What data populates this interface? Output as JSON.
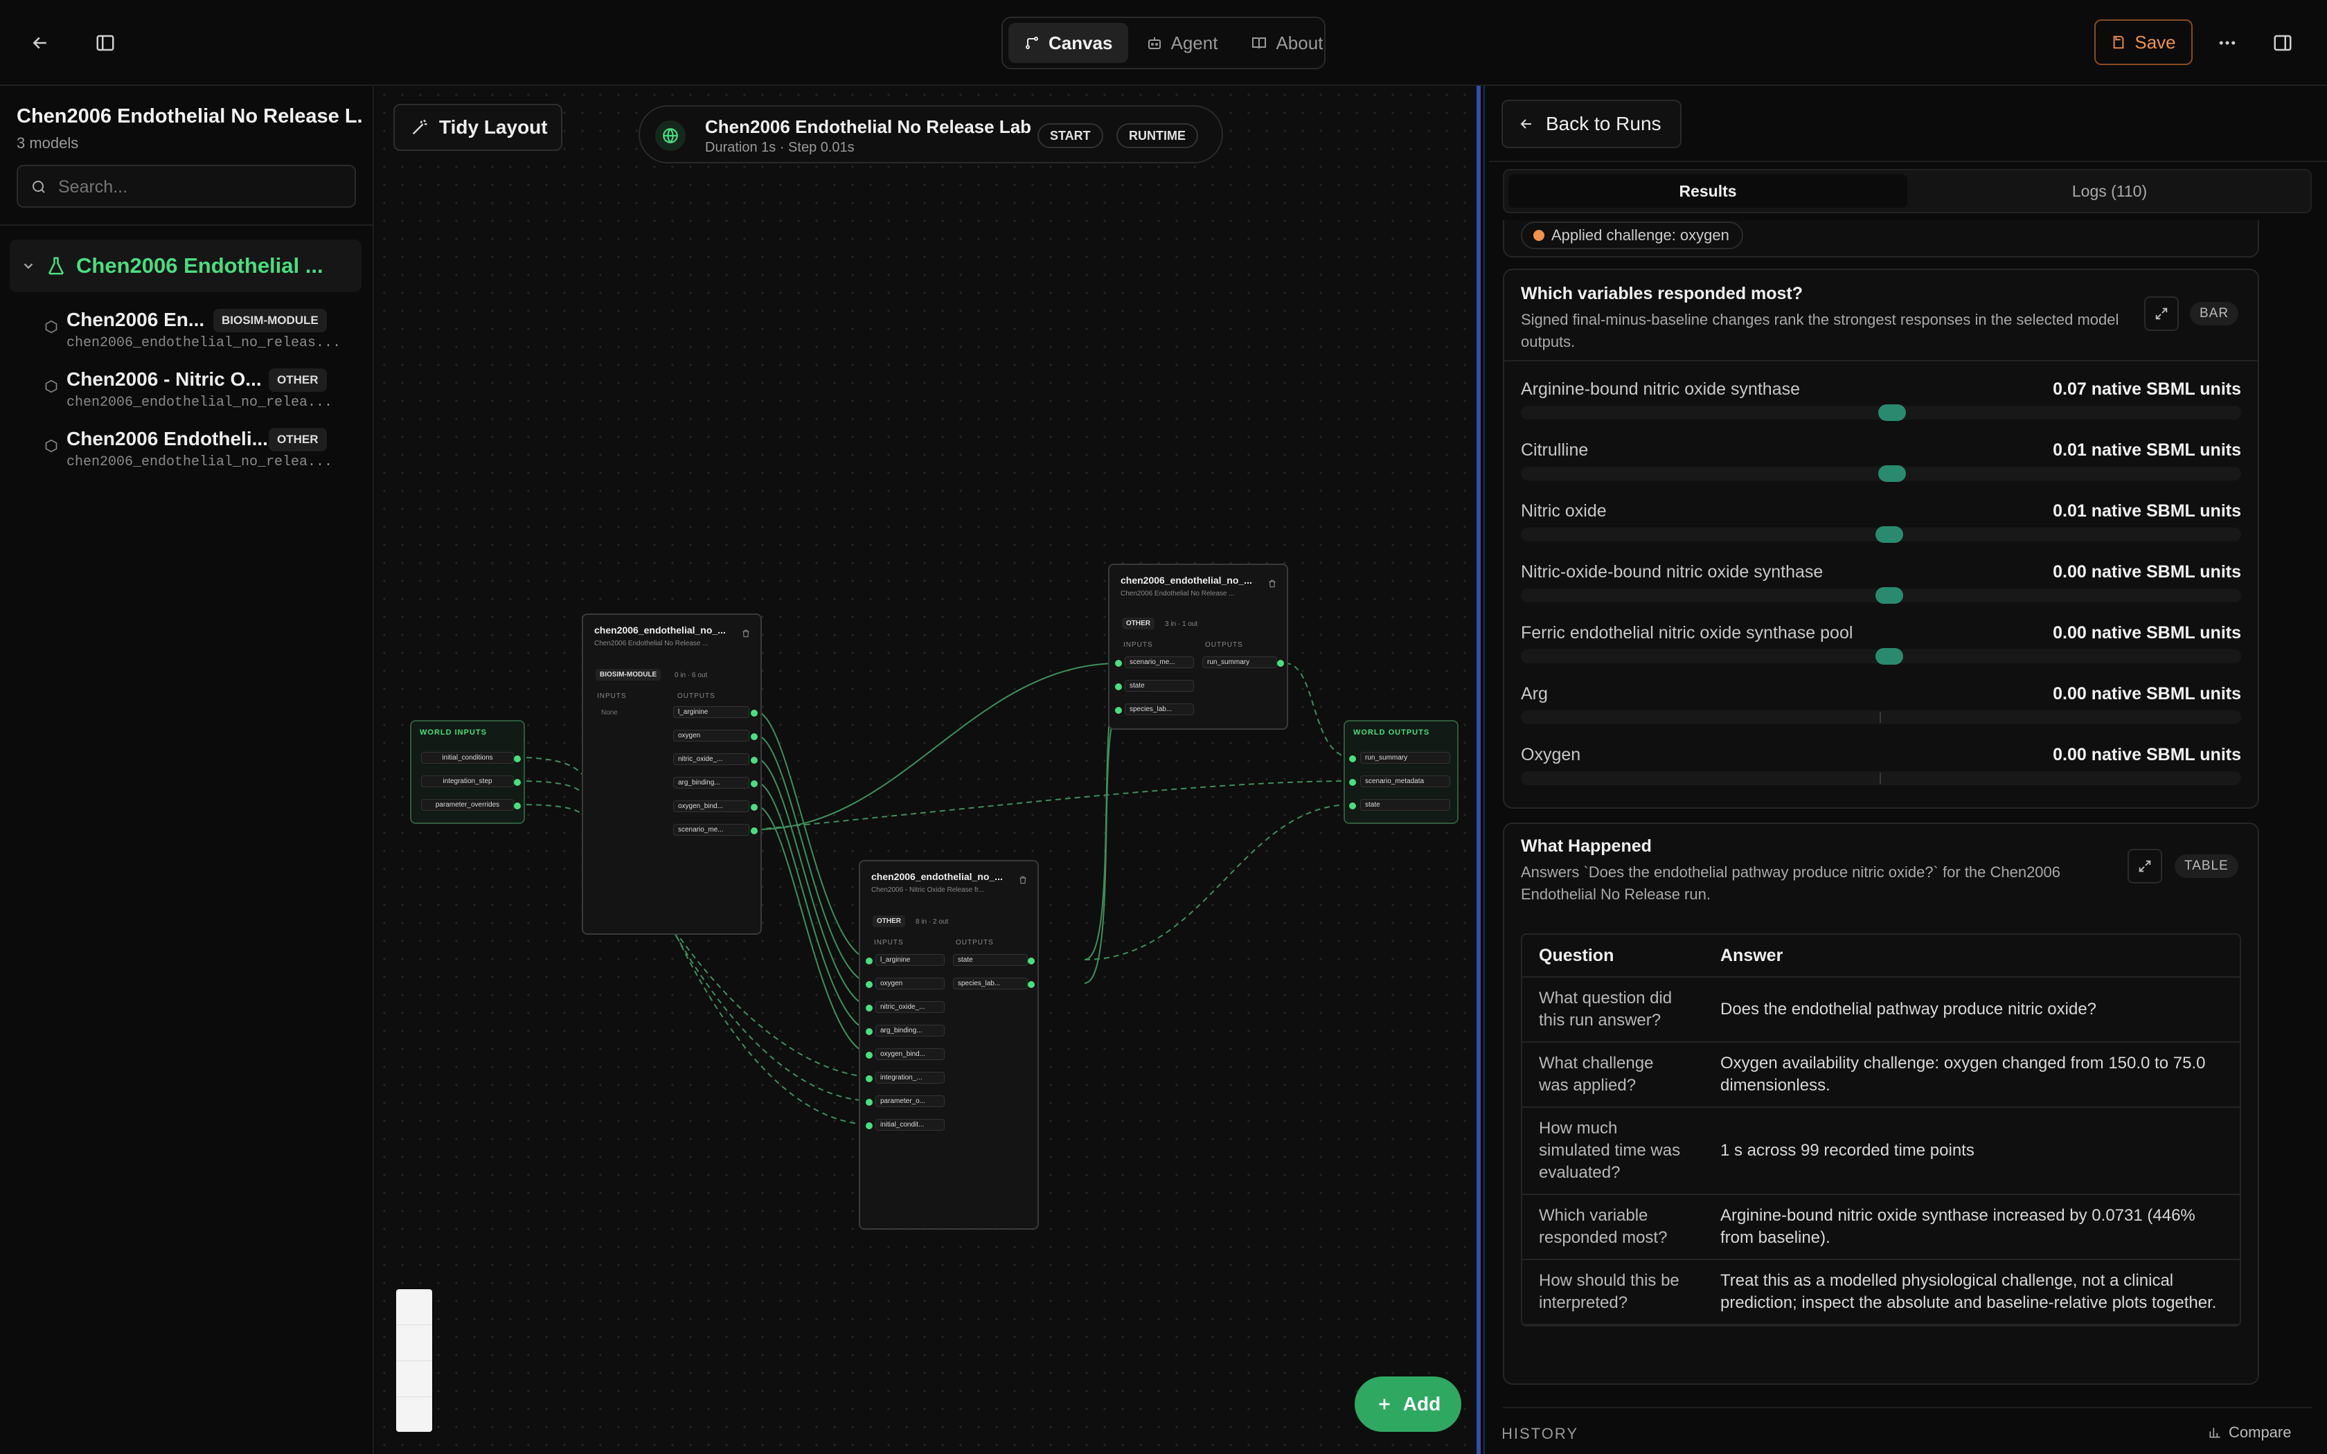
{
  "topbar": {
    "modes": [
      {
        "label": "Canvas",
        "active": true
      },
      {
        "label": "Agent",
        "active": false
      },
      {
        "label": "About",
        "active": false
      }
    ],
    "save_label": "Save",
    "accent_color": "#f0924a"
  },
  "sidebar": {
    "title": "Chen2006 Endothelial No Release L...",
    "subtitle": "3 models",
    "search_placeholder": "Search...",
    "group_label": "Chen2006 Endothelial ...",
    "items": [
      {
        "name": "Chen2006 En...",
        "badge": "BIOSIM-MODULE",
        "id": "chen2006_endothelial_no_releas..."
      },
      {
        "name": "Chen2006 - Nitric O...",
        "badge": "OTHER",
        "id": "chen2006_endothelial_no_relea..."
      },
      {
        "name": "Chen2006 Endotheli...",
        "badge": "OTHER",
        "id": "chen2006_endothelial_no_relea..."
      }
    ]
  },
  "canvas": {
    "tidy_label": "Tidy Layout",
    "run_title": "Chen2006 Endothelial No Release Lab",
    "run_meta": "Duration 1s · Step 0.01s",
    "tag_start": "START",
    "tag_runtime": "RUNTIME",
    "add_label": "Add",
    "world_inputs": {
      "label": "WORLD INPUTS",
      "ports": [
        "initial_conditions",
        "integration_step",
        "parameter_overrides"
      ]
    },
    "world_outputs": {
      "label": "WORLD OUTPUTS",
      "ports": [
        "run_summary",
        "scenario_metadata",
        "state"
      ]
    },
    "node1": {
      "title": "chen2006_endothelial_no_...",
      "subtitle": "Chen2006 Endothelial No Release ...",
      "badge": "BIOSIM-MODULE",
      "io": "0 in · 6 out",
      "inputs_label": "INPUTS",
      "outputs_label": "OUTPUTS",
      "none": "None",
      "outputs": [
        "l_arginine",
        "oxygen",
        "nitric_oxide_...",
        "arg_binding...",
        "oxygen_bind...",
        "scenario_me..."
      ]
    },
    "node2": {
      "title": "chen2006_endothelial_no_...",
      "subtitle": "Chen2006 Endothelial No Release ...",
      "badge": "OTHER",
      "io": "3 in · 1 out",
      "inputs_label": "INPUTS",
      "outputs_label": "OUTPUTS",
      "inputs": [
        "scenario_me...",
        "state",
        "species_lab..."
      ],
      "outputs": [
        "run_summary"
      ]
    },
    "node3": {
      "title": "chen2006_endothelial_no_...",
      "subtitle": "Chen2006 - Nitric Oxide Release fr...",
      "badge": "OTHER",
      "io": "8 in · 2 out",
      "inputs_label": "INPUTS",
      "outputs_label": "OUTPUTS",
      "inputs": [
        "l_arginine",
        "oxygen",
        "nitric_oxide_...",
        "arg_binding...",
        "oxygen_bind...",
        "integration_...",
        "parameter_o...",
        "initial_condit..."
      ],
      "outputs": [
        "state",
        "species_lab..."
      ]
    }
  },
  "panel": {
    "back_label": "Back to Runs",
    "tabs": [
      {
        "label": "Results",
        "active": true
      },
      {
        "label": "Logs (110)",
        "active": false
      }
    ],
    "clipped_text": "Applied challenge: oxygen",
    "responded": {
      "title": "Which variables responded most?",
      "description": "Signed final-minus-baseline changes rank the strongest responses in the selected model outputs.",
      "badge": "BAR",
      "unit": "native SBML units",
      "rows": [
        {
          "name": "Arginine-bound nitric oxide synthase",
          "value": "0.07 native SBML units",
          "level": 0.07
        },
        {
          "name": "Citrulline",
          "value": "0.01 native SBML units",
          "level": 0.01
        },
        {
          "name": "Nitric oxide",
          "value": "0.01 native SBML units",
          "level": 0.01
        },
        {
          "name": "Nitric-oxide-bound nitric oxide synthase",
          "value": "0.00 native SBML units",
          "level": 0.004
        },
        {
          "name": "Ferric endothelial nitric oxide synthase pool",
          "value": "0.00 native SBML units",
          "level": 0.004
        },
        {
          "name": "Arg",
          "value": "0.00 native SBML units",
          "level": 0.0
        },
        {
          "name": "Oxygen",
          "value": "0.00 native SBML units",
          "level": 0.0
        }
      ]
    },
    "happened": {
      "title": "What Happened",
      "description": "Answers `Does the endothelial pathway produce nitric oxide?` for the Chen2006 Endothelial No Release run.",
      "badge": "TABLE",
      "headers": [
        "Question",
        "Answer"
      ],
      "rows": [
        {
          "q": "What question did this run answer?",
          "a": "Does the endothelial pathway produce nitric oxide?"
        },
        {
          "q": "What challenge was applied?",
          "a": "Oxygen availability challenge: oxygen changed from 150.0 to 75.0 dimensionless."
        },
        {
          "q": "How much simulated time was evaluated?",
          "a": "1 s across 99 recorded time points"
        },
        {
          "q": "Which variable responded most?",
          "a": "Arginine-bound nitric oxide synthase increased by 0.0731 (446% from baseline)."
        },
        {
          "q": "How should this be interpreted?",
          "a": "Treat this as a modelled physiological challenge, not a clinical prediction; inspect the absolute and baseline-relative plots together."
        }
      ]
    },
    "history_label": "HISTORY",
    "compare_label": "Compare"
  }
}
